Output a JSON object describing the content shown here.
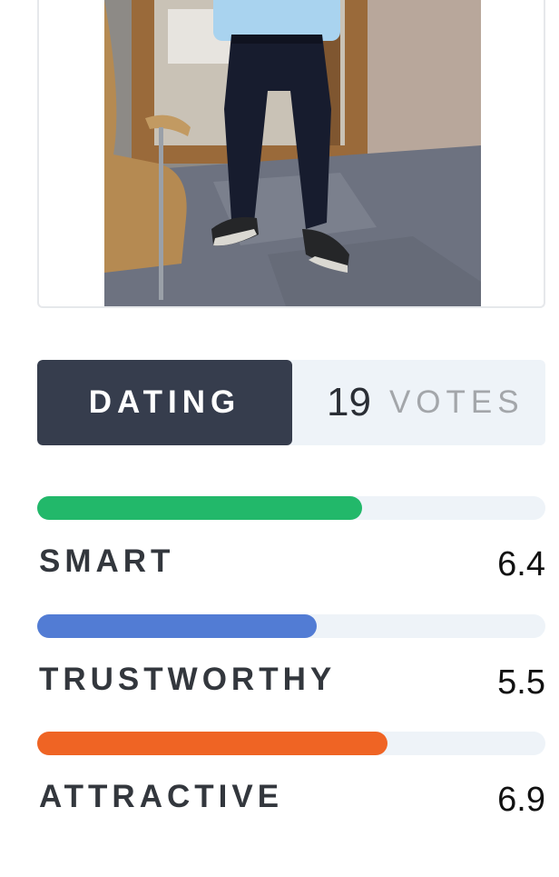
{
  "rating": {
    "category_label": "DATING",
    "vote_count": "19",
    "votes_label": "VOTES"
  },
  "traits": [
    {
      "label": "SMART",
      "score": "6.4",
      "bar_fraction": 0.64,
      "color": "#22b86a"
    },
    {
      "label": "TRUSTWORTHY",
      "score": "5.5",
      "bar_fraction": 0.55,
      "color": "#527cd4"
    },
    {
      "label": "ATTRACTIVE",
      "score": "6.9",
      "bar_fraction": 0.69,
      "color": "#ef6424"
    }
  ]
}
